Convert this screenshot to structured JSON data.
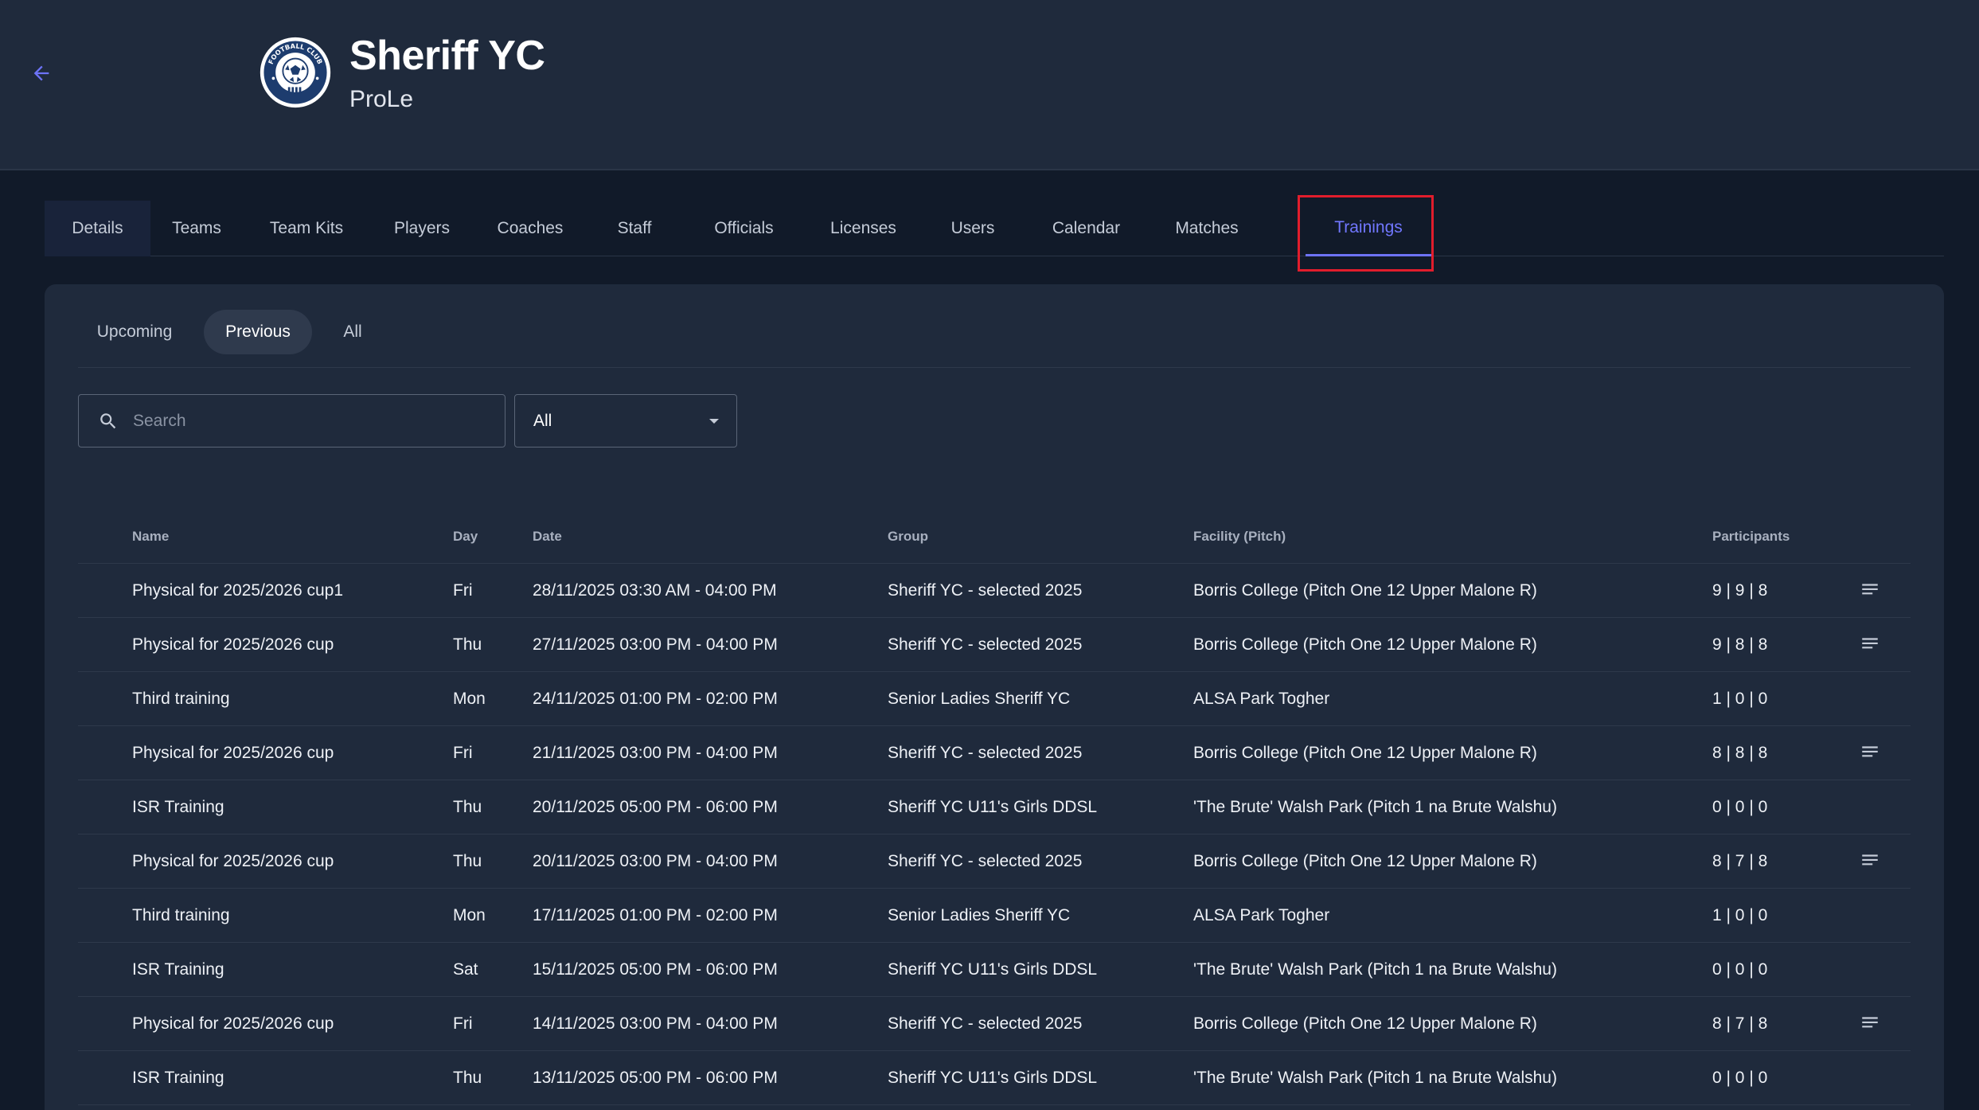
{
  "header": {
    "back_icon": "arrow-left-icon",
    "logo": "football-club-crest",
    "logo_text": "FOOTBALL CLUB",
    "club_name": "Sheriff YC",
    "subtitle": "ProLe"
  },
  "tabs": [
    {
      "label": "Details"
    },
    {
      "label": "Teams"
    },
    {
      "label": "Team Kits"
    },
    {
      "label": "Players"
    },
    {
      "label": "Coaches"
    },
    {
      "label": "Staff"
    },
    {
      "label": "Officials"
    },
    {
      "label": "Licenses"
    },
    {
      "label": "Users"
    },
    {
      "label": "Calendar"
    },
    {
      "label": "Matches"
    },
    {
      "label": "Trainings"
    }
  ],
  "active_tab": "Trainings",
  "subtabs": [
    {
      "label": "Upcoming"
    },
    {
      "label": "Previous"
    },
    {
      "label": "All"
    }
  ],
  "active_subtab": "Previous",
  "search": {
    "placeholder": "Search",
    "value": "",
    "icon": "search-icon"
  },
  "filter": {
    "value": "All",
    "icon": "caret-down-icon"
  },
  "table": {
    "headers": {
      "name": "Name",
      "day": "Day",
      "date": "Date",
      "group": "Group",
      "facility": "Facility (Pitch)",
      "participants": "Participants"
    },
    "row_action_icon": "lines-menu-icon",
    "rows": [
      {
        "name": "Physical for 2025/2026 cup1",
        "day": "Fri",
        "date": "28/11/2025 03:30 AM - 04:00 PM",
        "group": "Sheriff YC - selected 2025",
        "facility": "Borris College (Pitch One 12 Upper Malone R)",
        "participants": "9 | 9 | 8",
        "has_menu": true
      },
      {
        "name": "Physical for 2025/2026 cup",
        "day": "Thu",
        "date": "27/11/2025 03:00 PM - 04:00 PM",
        "group": "Sheriff YC - selected 2025",
        "facility": "Borris College (Pitch One 12 Upper Malone R)",
        "participants": "9 | 8 | 8",
        "has_menu": true
      },
      {
        "name": "Third training",
        "day": "Mon",
        "date": "24/11/2025 01:00 PM - 02:00 PM",
        "group": "Senior Ladies Sheriff YC",
        "facility": "ALSA Park Togher",
        "participants": "1 | 0 | 0",
        "has_menu": false
      },
      {
        "name": "Physical for 2025/2026 cup",
        "day": "Fri",
        "date": "21/11/2025 03:00 PM - 04:00 PM",
        "group": "Sheriff YC - selected 2025",
        "facility": "Borris College (Pitch One 12 Upper Malone R)",
        "participants": "8 | 8 | 8",
        "has_menu": true
      },
      {
        "name": "ISR Training",
        "day": "Thu",
        "date": "20/11/2025 05:00 PM - 06:00 PM",
        "group": "Sheriff YC U11's Girls DDSL",
        "facility": "'The Brute' Walsh Park (Pitch 1 na Brute Walshu)",
        "participants": "0 | 0 | 0",
        "has_menu": false
      },
      {
        "name": "Physical for 2025/2026 cup",
        "day": "Thu",
        "date": "20/11/2025 03:00 PM - 04:00 PM",
        "group": "Sheriff YC - selected 2025",
        "facility": "Borris College (Pitch One 12 Upper Malone R)",
        "participants": "8 | 7 | 8",
        "has_menu": true
      },
      {
        "name": "Third training",
        "day": "Mon",
        "date": "17/11/2025 01:00 PM - 02:00 PM",
        "group": "Senior Ladies Sheriff YC",
        "facility": "ALSA Park Togher",
        "participants": "1 | 0 | 0",
        "has_menu": false
      },
      {
        "name": "ISR Training",
        "day": "Sat",
        "date": "15/11/2025 05:00 PM - 06:00 PM",
        "group": "Sheriff YC U11's Girls DDSL",
        "facility": "'The Brute' Walsh Park (Pitch 1 na Brute Walshu)",
        "participants": "0 | 0 | 0",
        "has_menu": false
      },
      {
        "name": "Physical for 2025/2026 cup",
        "day": "Fri",
        "date": "14/11/2025 03:00 PM - 04:00 PM",
        "group": "Sheriff YC - selected 2025",
        "facility": "Borris College (Pitch One 12 Upper Malone R)",
        "participants": "8 | 7 | 8",
        "has_menu": true
      },
      {
        "name": "ISR Training",
        "day": "Thu",
        "date": "13/11/2025 05:00 PM - 06:00 PM",
        "group": "Sheriff YC U11's Girls DDSL",
        "facility": "'The Brute' Walsh Park (Pitch 1 na Brute Walshu)",
        "participants": "0 | 0 | 0",
        "has_menu": false
      }
    ]
  },
  "colors": {
    "background": "#111a29",
    "header": "#1f2a3c",
    "accent": "#6d73f7",
    "highlight": "#e11d2c"
  }
}
